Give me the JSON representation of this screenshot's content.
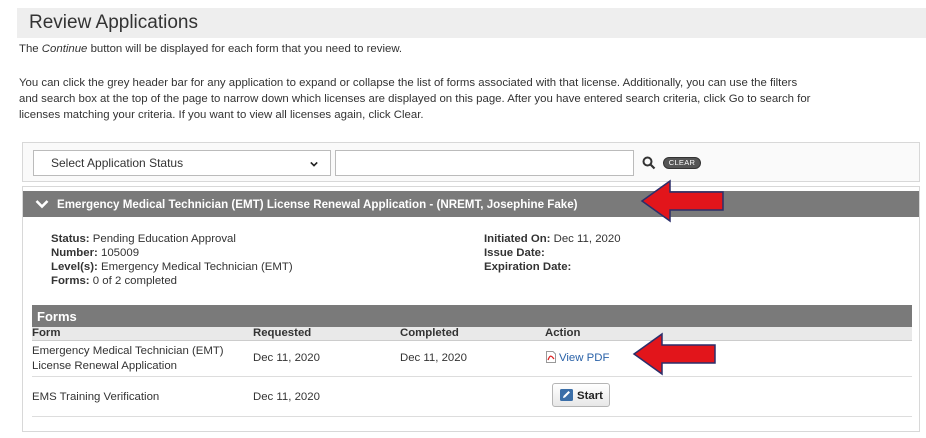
{
  "page": {
    "title": "Review Applications",
    "intro_line1_pre": "The ",
    "intro_line1_em": "Continue",
    "intro_line1_post": " button will be displayed for each form that you need to review.",
    "intro_line2": "You can click the grey header bar for any application to expand or collapse the list of forms associated with that license. Additionally, you can use the filters",
    "intro_line3": "and search box at the top of the page to narrow down which licenses are displayed on this page. After you have entered search criteria, click Go to search for",
    "intro_line4": "licenses matching your criteria. If you want to view all licenses again, click Clear."
  },
  "filters": {
    "status_select": "Select Application Status",
    "search_value": "",
    "clear_label": "CLEAR"
  },
  "application": {
    "header": "Emergency Medical Technician (EMT) License Renewal Application - (NREMT, Josephine Fake)",
    "status_label": "Status:",
    "status_value": "Pending Education Approval",
    "number_label": "Number:",
    "number_value": "105009",
    "levels_label": "Level(s):",
    "levels_value": "Emergency Medical Technician (EMT)",
    "forms_label": "Forms:",
    "forms_value": "0 of 2 completed",
    "initiated_label": "Initiated On:",
    "initiated_value": "Dec 11, 2020",
    "issue_label": "Issue Date:",
    "issue_value": "",
    "expiration_label": "Expiration Date:",
    "expiration_value": ""
  },
  "forms": {
    "title": "Forms",
    "columns": [
      "Form",
      "Requested",
      "Completed",
      "Action"
    ],
    "rows": [
      {
        "form_line1": "Emergency Medical Technician (EMT)",
        "form_line2": "License Renewal Application",
        "requested": "Dec 11, 2020",
        "completed": "Dec 11, 2020",
        "action": "View PDF"
      },
      {
        "form_line1": "EMS Training Verification",
        "requested": "Dec 11, 2020",
        "completed": "",
        "action": "Start"
      }
    ]
  },
  "colors": {
    "header_grey": "#7a7a7a",
    "link_blue": "#2a62a8",
    "annotation_arrow": "#e2151b"
  },
  "icons": [
    "chevron-down-icon",
    "search-icon",
    "pdf-icon",
    "edit-icon",
    "annotation-arrow"
  ]
}
